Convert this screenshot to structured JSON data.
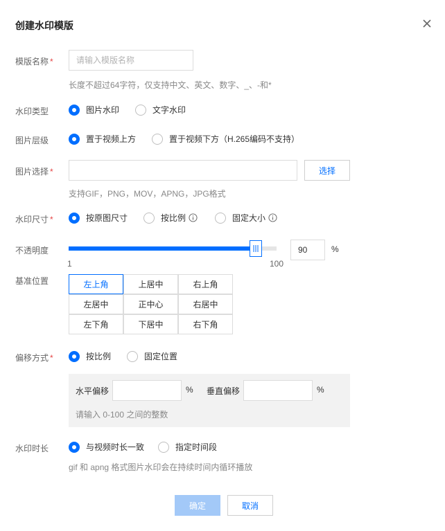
{
  "dialog": {
    "title": "创建水印模版"
  },
  "form": {
    "name": {
      "label": "模版名称",
      "required_mark": "*",
      "placeholder": "请输入模版名称",
      "hint": "长度不超过64字符，仅支持中文、英文、数字、_、-和*"
    },
    "type": {
      "label": "水印类型",
      "options": [
        "图片水印",
        "文字水印"
      ],
      "selected": "图片水印"
    },
    "layer": {
      "label": "图片层级",
      "options": [
        "置于视频上方",
        "置于视频下方（H.265编码不支持）"
      ],
      "selected": "置于视频上方"
    },
    "image": {
      "label": "图片选择",
      "required_mark": "*",
      "value": "",
      "select_button": "选择",
      "hint": "支持GIF，PNG，MOV，APNG，JPG格式"
    },
    "size": {
      "label": "水印尺寸",
      "required_mark": "*",
      "options": [
        "按原图尺寸",
        "按比例",
        "固定大小"
      ],
      "selected": "按原图尺寸"
    },
    "opacity": {
      "label": "不透明度",
      "min_label": "1",
      "max_label": "100",
      "value": "90",
      "unit": "%",
      "fraction": 0.9
    },
    "position": {
      "label": "基准位置",
      "cells": [
        [
          "左上角",
          "上居中",
          "右上角"
        ],
        [
          "左居中",
          "正中心",
          "右居中"
        ],
        [
          "左下角",
          "下居中",
          "右下角"
        ]
      ],
      "selected": "左上角"
    },
    "offset": {
      "label": "偏移方式",
      "required_mark": "*",
      "options": [
        "按比例",
        "固定位置"
      ],
      "selected": "按比例",
      "horizontal_label": "水平偏移",
      "horizontal_value": "",
      "horizontal_unit": "%",
      "vertical_label": "垂直偏移",
      "vertical_value": "",
      "vertical_unit": "%",
      "hint": "请输入 0-100 之间的整数"
    },
    "duration": {
      "label": "水印时长",
      "options": [
        "与视频时长一致",
        "指定时间段"
      ],
      "selected": "与视频时长一致",
      "hint": "gif 和 apng 格式图片水印会在持续时间内循环播放"
    }
  },
  "footer": {
    "ok_label": "确定",
    "cancel_label": "取消"
  },
  "colors": {
    "primary": "#006eff",
    "primary_disabled": "#a3c9f8",
    "required": "#e54545",
    "track": "#e5e5e5"
  }
}
